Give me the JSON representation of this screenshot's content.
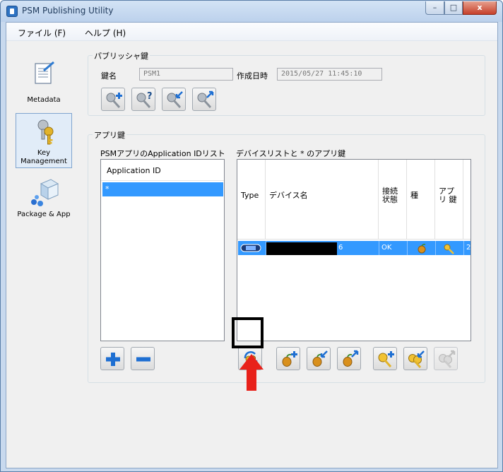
{
  "window": {
    "title": "PSM Publishing Utility",
    "close_symbol": "x",
    "maximize_symbol": "□",
    "minimize_symbol": "–"
  },
  "menu": {
    "file": "ファイル (F)",
    "help": "ヘルプ (H)"
  },
  "sidebar": {
    "items": [
      {
        "label": "Metadata",
        "icon": "metadata-document-icon"
      },
      {
        "label": "Key Management",
        "icon": "keys-icon",
        "active": true
      },
      {
        "label": "Package & App",
        "icon": "package-icon"
      }
    ]
  },
  "publisher_key": {
    "group_title": "パブリッシャ鍵",
    "key_name_label": "鍵名",
    "key_name_value": "PSM1",
    "created_label": "作成日時",
    "created_value": "2015/05/27 11:45:10",
    "buttons": [
      "add-key",
      "key-info",
      "import-key",
      "export-key"
    ]
  },
  "app_key": {
    "group_title": "アプリ鍵",
    "app_id_list_title": "PSMアプリのApplication IDリスト",
    "app_id_column": "Application ID",
    "app_ids": [
      "*"
    ],
    "device_list_title": "デバイスリストと * のアプリ鍵",
    "columns": {
      "type": "Type",
      "device_name": "デバイス名",
      "connection_status": "接続 状態",
      "seed": "種",
      "app_key": "アプリ 鍵"
    },
    "devices": [
      {
        "device_name_suffix": "6",
        "connection_status": "OK",
        "extra": "2"
      }
    ]
  },
  "colors": {
    "selection": "#3399ff",
    "accent_arrow": "#e8211a",
    "key_gold": "#e2b32a"
  }
}
